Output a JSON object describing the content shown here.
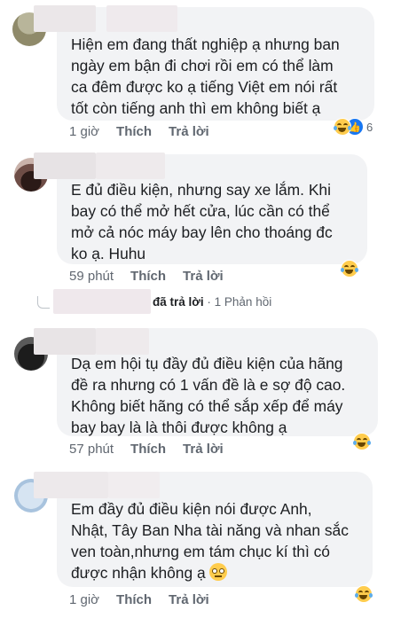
{
  "comments": [
    {
      "lines": [
        "Hiện em đang thất nghiệp ạ nhưng ban",
        "ngày em bận đi chơi rồi em có thể làm",
        "ca đêm được ko ạ tiếng Việt em nói rất",
        "tốt còn tiếng anh thì em không biết ạ"
      ],
      "time": "1 giờ",
      "like_label": "Thích",
      "reply_label": "Trả lời",
      "reaction_count": "6",
      "reaction_icons": [
        "laugh-emoji",
        "like-thumb"
      ]
    },
    {
      "lines": [
        "E đủ điều kiện, nhưng say xe lắm. Khi",
        "bay có thể mở hết cửa, lúc cần có thể",
        "mở cả nóc máy bay lên cho thoáng đc",
        "ko ạ. Huhu"
      ],
      "time": "59 phút",
      "like_label": "Thích",
      "reply_label": "Trả lời",
      "reaction_count": "",
      "reaction_icons": [
        "laugh-emoji"
      ],
      "reply_summary": {
        "action": "đã trả lời",
        "separator": "·",
        "count": "1 Phản hồi"
      }
    },
    {
      "lines": [
        "Dạ em hội tụ đầy đủ điều kiện của hãng",
        "đề ra nhưng có 1 vấn đề là e sợ độ cao.",
        "Không biết hãng có thể sắp xếp để máy",
        "bay bay là là thôi được không ạ"
      ],
      "time": "57 phút",
      "like_label": "Thích",
      "reply_label": "Trả lời",
      "reaction_count": "",
      "reaction_icons": [
        "laugh-emoji"
      ]
    },
    {
      "lines": [
        "Em đầy đủ điều kiện nói được Anh,",
        "Nhật, Tây Ban Nha tài năng và nhan sắc",
        "ven toàn,nhưng em tám chục kí thì có",
        "được nhận không ạ"
      ],
      "time": "1 giờ",
      "like_label": "Thích",
      "reply_label": "Trả lời",
      "reaction_count": "",
      "reaction_icons": [
        "laugh-emoji"
      ],
      "inline_emoji": "rolling-eyes-emoji"
    }
  ]
}
